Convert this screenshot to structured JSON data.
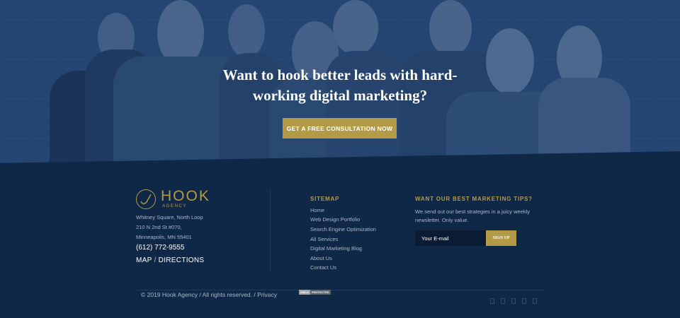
{
  "hero": {
    "title": "Want to hook better leads with hard-working digital marketing?",
    "cta_label": "GET A FREE CONSULTATION NOW"
  },
  "brand": {
    "name": "HOOK",
    "sub": "AGENCY",
    "gold": "#b39a47",
    "navy": "#0f2847"
  },
  "contact": {
    "address_lines": [
      "Whitney Square, North Loop",
      "210 N 2nd St #070,",
      "Minneapolis, MN 55401"
    ],
    "phone": "(612) 772-9555",
    "map_label": "MAP",
    "separator": "/",
    "directions_label": "DIRECTIONS"
  },
  "sitemap": {
    "title": "SITEMAP",
    "links": [
      "Home",
      "Web Design Portfolio",
      "Search Engine Optimization",
      "All Services",
      "Digital Marketing Blog",
      "About Us",
      "Contact Us"
    ]
  },
  "newsletter": {
    "title": "WANT OUR BEST MARKETING TIPS?",
    "text": "We send out our best strategies in a juicy weekly newsletter. Only value.",
    "email_placeholder": "Your E-mail",
    "signup_label": "SIGN UP"
  },
  "bottom": {
    "copyright": "© 2019 Hook Agency / All rights reserved. / ",
    "privacy_label": "Privacy",
    "dmca_left": "DMCA",
    "dmca_right": "PROTECTED"
  },
  "social_icons": [
    "facebook-icon",
    "twitter-icon",
    "instagram-icon",
    "linkedin-icon",
    "youtube-icon"
  ]
}
